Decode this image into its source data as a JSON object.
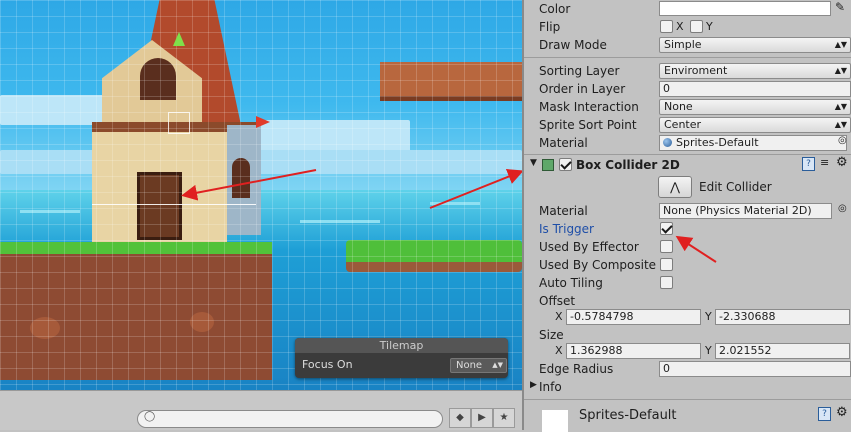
{
  "scene": {
    "tilemap_panel": {
      "title": "Tilemap",
      "focus_label": "Focus On",
      "focus_value": "None"
    }
  },
  "inspector": {
    "sprite_renderer": {
      "color_label": "Color",
      "flip_label": "Flip",
      "flip_x": "X",
      "flip_y": "Y",
      "draw_mode_label": "Draw Mode",
      "draw_mode_value": "Simple",
      "sorting_layer_label": "Sorting Layer",
      "sorting_layer_value": "Enviroment",
      "order_label": "Order in Layer",
      "order_value": "0",
      "mask_label": "Mask Interaction",
      "mask_value": "None",
      "sort_point_label": "Sprite Sort Point",
      "sort_point_value": "Center",
      "material_label": "Material",
      "material_value": "Sprites-Default"
    },
    "box_collider": {
      "title": "Box Collider 2D",
      "edit_label": "Edit Collider",
      "material_label": "Material",
      "material_value": "None (Physics Material 2D)",
      "is_trigger_label": "Is Trigger",
      "is_trigger": true,
      "used_by_effector_label": "Used By Effector",
      "used_by_composite_label": "Used By Composite",
      "auto_tiling_label": "Auto Tiling",
      "offset_label": "Offset",
      "offset_x_label": "X",
      "offset_x": "-0.5784798",
      "offset_y_label": "Y",
      "offset_y": "-2.330688",
      "size_label": "Size",
      "size_x_label": "X",
      "size_x": "1.362988",
      "size_y_label": "Y",
      "size_y": "2.021552",
      "edge_radius_label": "Edge Radius",
      "edge_radius_value": "0",
      "info_label": "Info"
    },
    "material_asset": {
      "name": "Sprites-Default"
    }
  },
  "colors": {
    "accent_label": "#1f4fa8",
    "annotation_arrow": "#e02020",
    "sky": "#3fb9ee",
    "sea": "#1e9fd6"
  }
}
